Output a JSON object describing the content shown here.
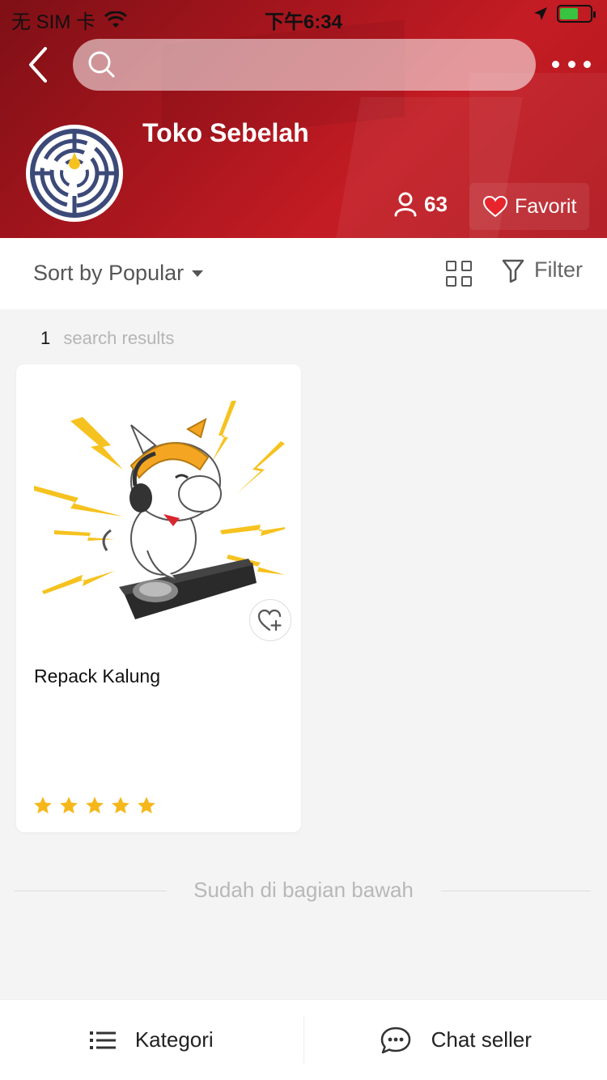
{
  "status_bar": {
    "carrier": "无 SIM 卡",
    "time": "下午6:34"
  },
  "header": {
    "search_placeholder": "",
    "shop_name": "Toko Sebelah",
    "followers": "63",
    "favorite_label": "Favorit"
  },
  "toolbar": {
    "sort_label": "Sort by Popular",
    "filter_label": "Filter"
  },
  "results": {
    "count": "1",
    "label": "search results"
  },
  "products": [
    {
      "title": "Repack Kalung",
      "rating": 5
    }
  ],
  "bottom_note": "Sudah di bagian bawah",
  "bottom_bar": {
    "category_label": "Kategori",
    "chat_label": "Chat seller"
  },
  "colors": {
    "brand": "#b5161e",
    "star": "#f5b71a",
    "heart": "#e8242c"
  }
}
